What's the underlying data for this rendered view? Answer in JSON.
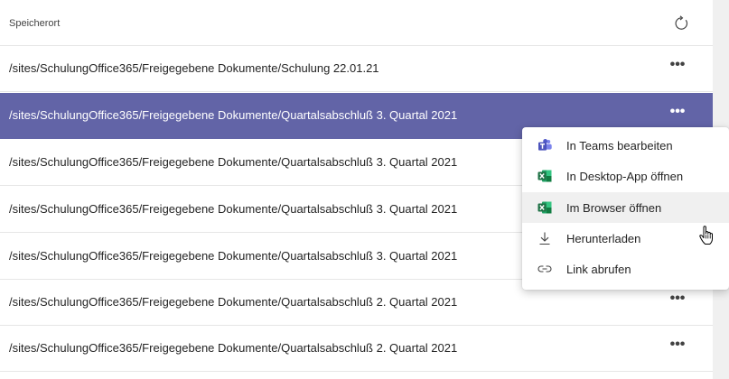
{
  "header": {
    "column_label": "Speicherort"
  },
  "rows": [
    {
      "path": "/sites/SchulungOffice365/Freigegebene Dokumente/Schulung 22.01.21",
      "more": "•••"
    },
    {
      "path": "/sites/SchulungOffice365/Freigegebene Dokumente/Quartalsabschluß 3. Quartal 2021",
      "more": "•••"
    },
    {
      "path": "/sites/SchulungOffice365/Freigegebene Dokumente/Quartalsabschluß 3. Quartal 2021",
      "more": ""
    },
    {
      "path": "/sites/SchulungOffice365/Freigegebene Dokumente/Quartalsabschluß 3. Quartal 2021",
      "more": ""
    },
    {
      "path": "/sites/SchulungOffice365/Freigegebene Dokumente/Quartalsabschluß 3. Quartal 2021",
      "more": ""
    },
    {
      "path": "/sites/SchulungOffice365/Freigegebene Dokumente/Quartalsabschluß 2. Quartal 2021",
      "more": "•••"
    },
    {
      "path": "/sites/SchulungOffice365/Freigegebene Dokumente/Quartalsabschluß 2. Quartal 2021",
      "more": "•••"
    }
  ],
  "context_menu": {
    "items": [
      {
        "label": "In Teams bearbeiten",
        "icon": "teams-icon"
      },
      {
        "label": "In Desktop-App öffnen",
        "icon": "excel-icon"
      },
      {
        "label": "Im Browser öffnen",
        "icon": "excel-icon"
      },
      {
        "label": "Herunterladen",
        "icon": "download-icon"
      },
      {
        "label": "Link abrufen",
        "icon": "link-icon"
      }
    ]
  },
  "colors": {
    "selected_row": "#6264a7",
    "excel_green": "#1e7145",
    "teams_purple": "#5059c9"
  }
}
